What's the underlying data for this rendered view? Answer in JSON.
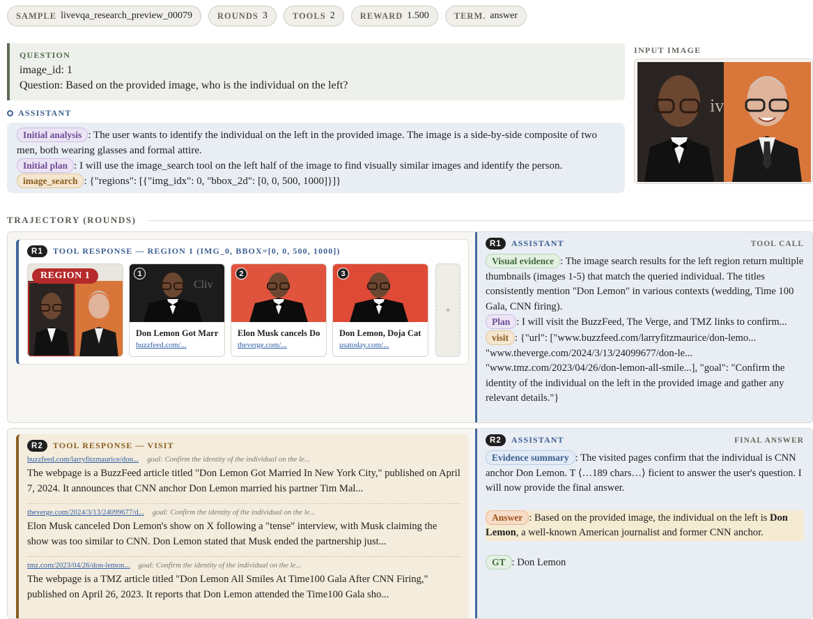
{
  "header": {
    "pills": [
      {
        "key": "SAMPLE",
        "value": "livevqa_research_preview_00079"
      },
      {
        "key": "ROUNDS",
        "value": "3"
      },
      {
        "key": "TOOLS",
        "value": "2"
      },
      {
        "key": "REWARD",
        "value": "1.500"
      },
      {
        "key": "TERM.",
        "value": "answer"
      }
    ]
  },
  "question": {
    "label": "QUESTION",
    "image_id_line": "image_id: 1",
    "question_line": "Question: Based on the provided image, who is the individual on the left?"
  },
  "input_image": {
    "label": "INPUT IMAGE"
  },
  "assistant_intro": {
    "label": "ASSISTANT",
    "analysis_tag": "Initial analysis",
    "analysis_text": ": The user wants to identify the individual on the left in the provided image. The image is a side-by-side composite of two men, both wearing glasses and formal attire.",
    "plan_tag": "Initial plan",
    "plan_text": ": I will use the image_search tool on the left half of the image to find visually similar images and identify the person.",
    "call_tag": "image_search",
    "call_text": ": {\"regions\": [{\"img_idx\": 0, \"bbox_2d\": [0, 0, 500, 1000]}]}"
  },
  "trajectory": {
    "label": "TRAJECTORY (ROUNDS)"
  },
  "round1": {
    "badge": "R1",
    "tool_title": "TOOL RESPONSE — REGION 1 (IMG_0, BBOX=[0, 0, 500, 1000])",
    "region_label": "REGION 1",
    "results": [
      {
        "num": "1",
        "title": "Don Lemon Got Marr",
        "url": "buzzfeed.com/..."
      },
      {
        "num": "2",
        "title": "Elon Musk cancels Do",
        "url": "theverge.com/..."
      },
      {
        "num": "3",
        "title": "Don Lemon, Doja Cat",
        "url": "usatoday.com/..."
      }
    ],
    "more_glyph": "+",
    "assistant": {
      "badge": "R1",
      "label": "ASSISTANT",
      "kind": "TOOL CALL",
      "evidence_tag": "Visual evidence",
      "evidence_text": ": The image search results for the left region return multiple thumbnails (images 1-5) that match the queried individual. The titles consistently mention \"Don Lemon\" in various contexts (wedding, Time 100 Gala, CNN firing).",
      "plan_tag": "Plan",
      "plan_text": ": I will visit the BuzzFeed, The Verge, and TMZ links to confirm...",
      "call_tag": "visit",
      "call_text": ": {\"url\": [\"www.buzzfeed.com/larryfitzmaurice/don-lemo... \"www.theverge.com/2024/3/13/24099677/don-le... \"www.tmz.com/2023/04/26/don-lemon-all-smile...], \"goal\": \"Confirm the identity of the individual on the left in the provided image and gather any relevant details.\"}"
    }
  },
  "round2": {
    "badge": "R2",
    "tool_title": "TOOL RESPONSE — VISIT",
    "visits": [
      {
        "url": "buzzfeed.com/larryfitzmaurice/don...",
        "goal": "goal: Confirm the identity of the individual on the le...",
        "text": "The webpage is a BuzzFeed article titled \"Don Lemon Got Married In New York City,\" published on April 7, 2024. It announces that CNN anchor Don Lemon married his partner Tim Mal..."
      },
      {
        "url": "theverge.com/2024/3/13/24099677/d...",
        "goal": "goal: Confirm the identity of the individual on the le...",
        "text": "Elon Musk canceled Don Lemon's show on X following a \"tense\" interview, with Musk claiming the show was too similar to CNN. Don Lemon stated that Musk ended the partnership just..."
      },
      {
        "url": "tmz.com/2023/04/26/don-lemon...",
        "goal": "goal: Confirm the identity of the individual on the le...",
        "text": "The webpage is a TMZ article titled \"Don Lemon All Smiles At Time100 Gala After CNN Firing,\" published on April 26, 2023. It reports that Don Lemon attended the Time100 Gala sho..."
      }
    ],
    "assistant": {
      "badge": "R2",
      "label": "ASSISTANT",
      "kind": "FINAL ANSWER",
      "summary_tag": "Evidence summary",
      "summary_text": ": The visited pages confirm that the individual is CNN anchor Don Lemon. T ⟨…189 chars…⟩ ficient to answer the user's question. I will now provide the final answer.",
      "answer_tag": "Answer",
      "answer_text": ": Based on the provided image, the individual on the left is ",
      "answer_bold": "Don Lemon",
      "answer_tail": ", a well-known American journalist and former CNN anchor.",
      "gt_tag": "GT",
      "gt_text": ": Don Lemon"
    }
  },
  "colors": {
    "accent_blue": "#41679a",
    "accent_brown": "#8a5d22",
    "region_red": "#b52a2a"
  }
}
